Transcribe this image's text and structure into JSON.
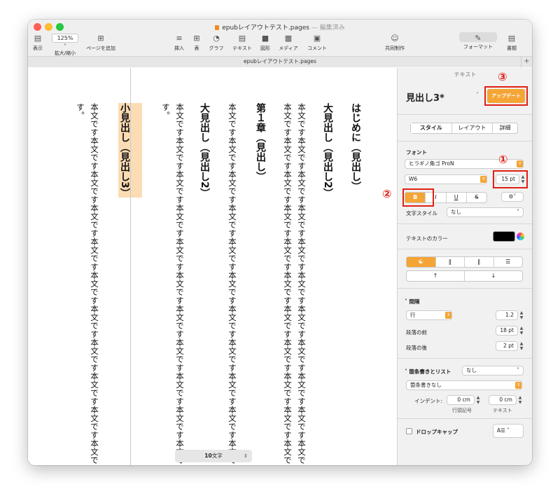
{
  "window": {
    "doc_title": "epubレイアウトテスト.pages",
    "edited_label": "— 編集済み",
    "tab_title": "epubレイアウトテスト.pages"
  },
  "toolbar": {
    "view_label": "表示",
    "zoom_value": "125%",
    "zoom_label": "拡大/縮小",
    "add_page_label": "ページを追加",
    "insert_label": "挿入",
    "table_label": "表",
    "chart_label": "グラフ",
    "text_label": "テキスト",
    "shape_label": "図形",
    "media_label": "メディア",
    "comment_label": "コメント",
    "collab_label": "共同制作",
    "format_label": "フォーマット",
    "document_label": "書類"
  },
  "document": {
    "columns": [
      {
        "kind": "head",
        "text": "はじめに（見出し）"
      },
      {
        "kind": "head",
        "text": "大見出し（見出し2）"
      },
      {
        "kind": "body",
        "text": "本文です本文です本文です本文です本文です本文です本文です本文です本文です本文です本文です"
      },
      {
        "kind": "body",
        "text": "本文です本文です本文です本文です本文です本文です本文です本文です本文です本文です本文です"
      },
      {
        "kind": "head",
        "text": "第１章（見出し）"
      },
      {
        "kind": "body",
        "text": "本文です本文です本文です本文です本文です本文です本文です本文です本文です本文です本文です"
      },
      {
        "kind": "head",
        "text": "大見出し（見出し2）"
      },
      {
        "kind": "body",
        "text": "本文です本文です本文です本文です本文です本文です本文です本文です本文です本文です本文です"
      },
      {
        "kind": "body",
        "text": "す。"
      },
      {
        "kind": "head",
        "text": "小見出し（見出し3）"
      },
      {
        "kind": "body",
        "text": "本文です本文です本文です本文です本文です本文です本文です本文です本文です本文です本文です"
      },
      {
        "kind": "body",
        "text": "す。"
      }
    ],
    "word_count": "10",
    "word_count_unit": "文字"
  },
  "sidebar": {
    "header": "テキスト",
    "style_name": "見出し3*",
    "update_button": "アップデート",
    "tabs": [
      "スタイル",
      "レイアウト",
      "詳細"
    ],
    "font_section": "フォント",
    "font_family": "ヒラギノ角ゴ ProN",
    "font_weight": "W6",
    "font_size": "15 pt",
    "format_buttons": [
      "B",
      "I",
      "U",
      "S"
    ],
    "char_style_label": "文字スタイル",
    "char_style_value": "なし",
    "text_color_label": "テキストのカラー",
    "text_color": "#000000",
    "spacing_section": "間隔",
    "line_mode": "行",
    "line_value": "1.2",
    "para_before_label": "段落の前",
    "para_before_value": "18 pt",
    "para_after_label": "段落の後",
    "para_after_value": "2 pt",
    "bullets_label": "箇条書きとリスト",
    "bullets_value": "なし",
    "bullets_style": "箇条書きなし",
    "indent_label": "インデント:",
    "indent_bullet_value": "0 cm",
    "indent_text_value": "0 cm",
    "indent_bullet_label": "行頭記号",
    "indent_text_label": "テキスト",
    "dropcap_label": "ドロップキャップ"
  },
  "annotations": {
    "one": "①",
    "two": "②",
    "three": "③",
    "color": "#e02015"
  }
}
